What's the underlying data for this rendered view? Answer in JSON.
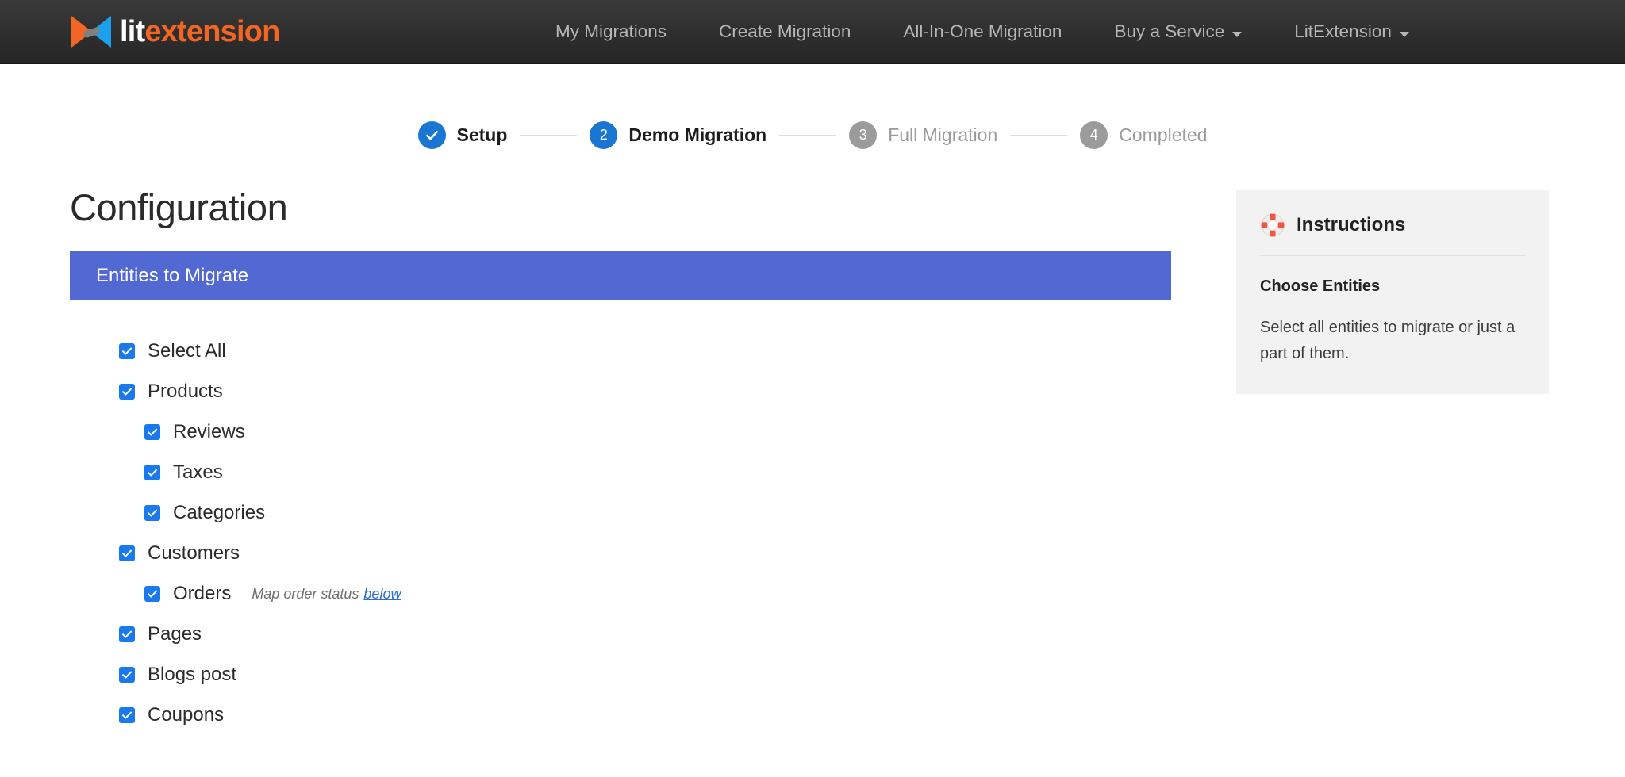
{
  "brand": {
    "text_primary": "lit",
    "text_secondary": "extension",
    "logo_icon": "litextension-arrows-logo",
    "color_orange": "#f26522",
    "color_blue": "#1ca0ee",
    "color_gray": "#808080"
  },
  "nav": {
    "items": [
      {
        "label": "My Migrations",
        "has_caret": false
      },
      {
        "label": "Create Migration",
        "has_caret": false
      },
      {
        "label": "All-In-One Migration",
        "has_caret": false
      },
      {
        "label": "Buy a Service",
        "has_caret": true
      },
      {
        "label": "LitExtension",
        "has_caret": true
      }
    ],
    "caret_icon": "chevron-down-icon"
  },
  "stepper": {
    "steps": [
      {
        "marker": "✓",
        "label": "Setup",
        "state": "done"
      },
      {
        "marker": "2",
        "label": "Demo Migration",
        "state": "active"
      },
      {
        "marker": "3",
        "label": "Full Migration",
        "state": "inactive"
      },
      {
        "marker": "4",
        "label": "Completed",
        "state": "inactive"
      }
    ],
    "active_color": "#1976d2",
    "inactive_color": "#9b9b9b"
  },
  "main": {
    "page_title": "Configuration",
    "section_title": "Entities to Migrate",
    "section_color": "#5268d2",
    "entities": [
      {
        "label": "Select All",
        "checked": true,
        "indent": false
      },
      {
        "label": "Products",
        "checked": true,
        "indent": false
      },
      {
        "label": "Reviews",
        "checked": true,
        "indent": true
      },
      {
        "label": "Taxes",
        "checked": true,
        "indent": true
      },
      {
        "label": "Categories",
        "checked": true,
        "indent": true
      },
      {
        "label": "Customers",
        "checked": true,
        "indent": false
      },
      {
        "label": "Orders",
        "checked": true,
        "indent": true,
        "note": "Map order status",
        "note_link": "below"
      },
      {
        "label": "Pages",
        "checked": true,
        "indent": false
      },
      {
        "label": "Blogs post",
        "checked": true,
        "indent": false
      },
      {
        "label": "Coupons",
        "checked": true,
        "indent": false
      }
    ],
    "checkbox_color": "#1a7aed"
  },
  "instructions": {
    "icon": "lifering-icon",
    "icon_color": "#f4553d",
    "title": "Instructions",
    "subtitle": "Choose Entities",
    "body": "Select all entities to migrate or just a part of them."
  }
}
